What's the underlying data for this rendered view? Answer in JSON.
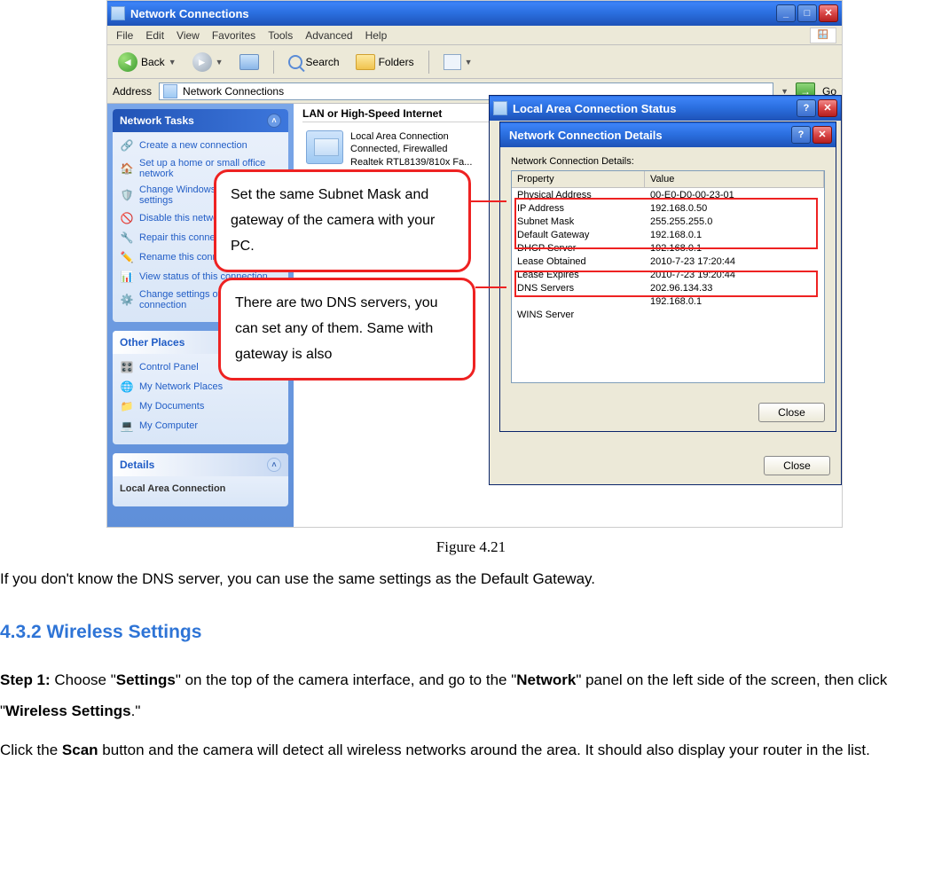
{
  "main": {
    "title": "Network Connections",
    "menus": [
      "File",
      "Edit",
      "View",
      "Favorites",
      "Tools",
      "Advanced",
      "Help"
    ],
    "toolbar": {
      "back": "Back",
      "search": "Search",
      "folders": "Folders"
    },
    "address": {
      "label": "Address",
      "value": "Network Connections",
      "go": "Go"
    },
    "lan_header": "LAN or High-Speed Internet",
    "lan_item": {
      "name": "Local Area Connection",
      "status": "Connected, Firewalled",
      "device": "Realtek RTL8139/810x Fa..."
    }
  },
  "sidebar": {
    "network_tasks": {
      "title": "Network Tasks",
      "items": [
        "Create a new connection",
        "Set up a home or small office network",
        "Change Windows Firewall settings",
        "Disable this network device",
        "Repair this connection",
        "Rename this connection",
        "View status of this connection",
        "Change settings of this connection"
      ]
    },
    "other_places": {
      "title": "Other Places",
      "items": [
        "Control Panel",
        "My Network Places",
        "My Documents",
        "My Computer"
      ]
    },
    "details": {
      "title": "Details",
      "content": "Local Area Connection"
    }
  },
  "status_window": {
    "title": "Local Area Connection Status",
    "close": "Close"
  },
  "details_window": {
    "title": "Network Connection Details",
    "label": "Network Connection Details:",
    "col_prop": "Property",
    "col_val": "Value",
    "rows": [
      {
        "p": "Physical Address",
        "v": "00-E0-D0-00-23-01"
      },
      {
        "p": "IP Address",
        "v": "192.168.0.50"
      },
      {
        "p": "Subnet Mask",
        "v": "255.255.255.0"
      },
      {
        "p": "Default Gateway",
        "v": "192.168.0.1"
      },
      {
        "p": "DHCP Server",
        "v": "192.168.0.1"
      },
      {
        "p": "Lease Obtained",
        "v": "2010-7-23 17:20:44"
      },
      {
        "p": "Lease Expires",
        "v": "2010-7-23 19:20:44"
      },
      {
        "p": "DNS Servers",
        "v": "202.96.134.33"
      },
      {
        "p": "",
        "v": "192.168.0.1"
      },
      {
        "p": "WINS Server",
        "v": ""
      }
    ],
    "close": "Close"
  },
  "annotations": {
    "c1": "Set the same Subnet Mask and gateway of the camera with your PC.",
    "c2": "There are two DNS servers, you can set any of them. Same with gateway is also"
  },
  "doc": {
    "caption": "Figure 4.21",
    "para1": "If you don't know the DNS server, you can use the same settings as the Default Gateway.",
    "heading": "4.3.2    Wireless Settings",
    "step1_a": "Step 1: ",
    "step1_b": "Choose \"",
    "step1_c": "Settings",
    "step1_d": "\" on the top of the camera interface, and go to the \"",
    "step1_e": "Network",
    "step1_f": "\" panel on the left side of the screen, then click \"",
    "step1_g": "Wireless Settings",
    "step1_h": ".\"",
    "p2a": "Click the ",
    "p2b": "Scan",
    "p2c": " button and the camera will detect all wireless networks around the area. It should also display your router in the list."
  }
}
